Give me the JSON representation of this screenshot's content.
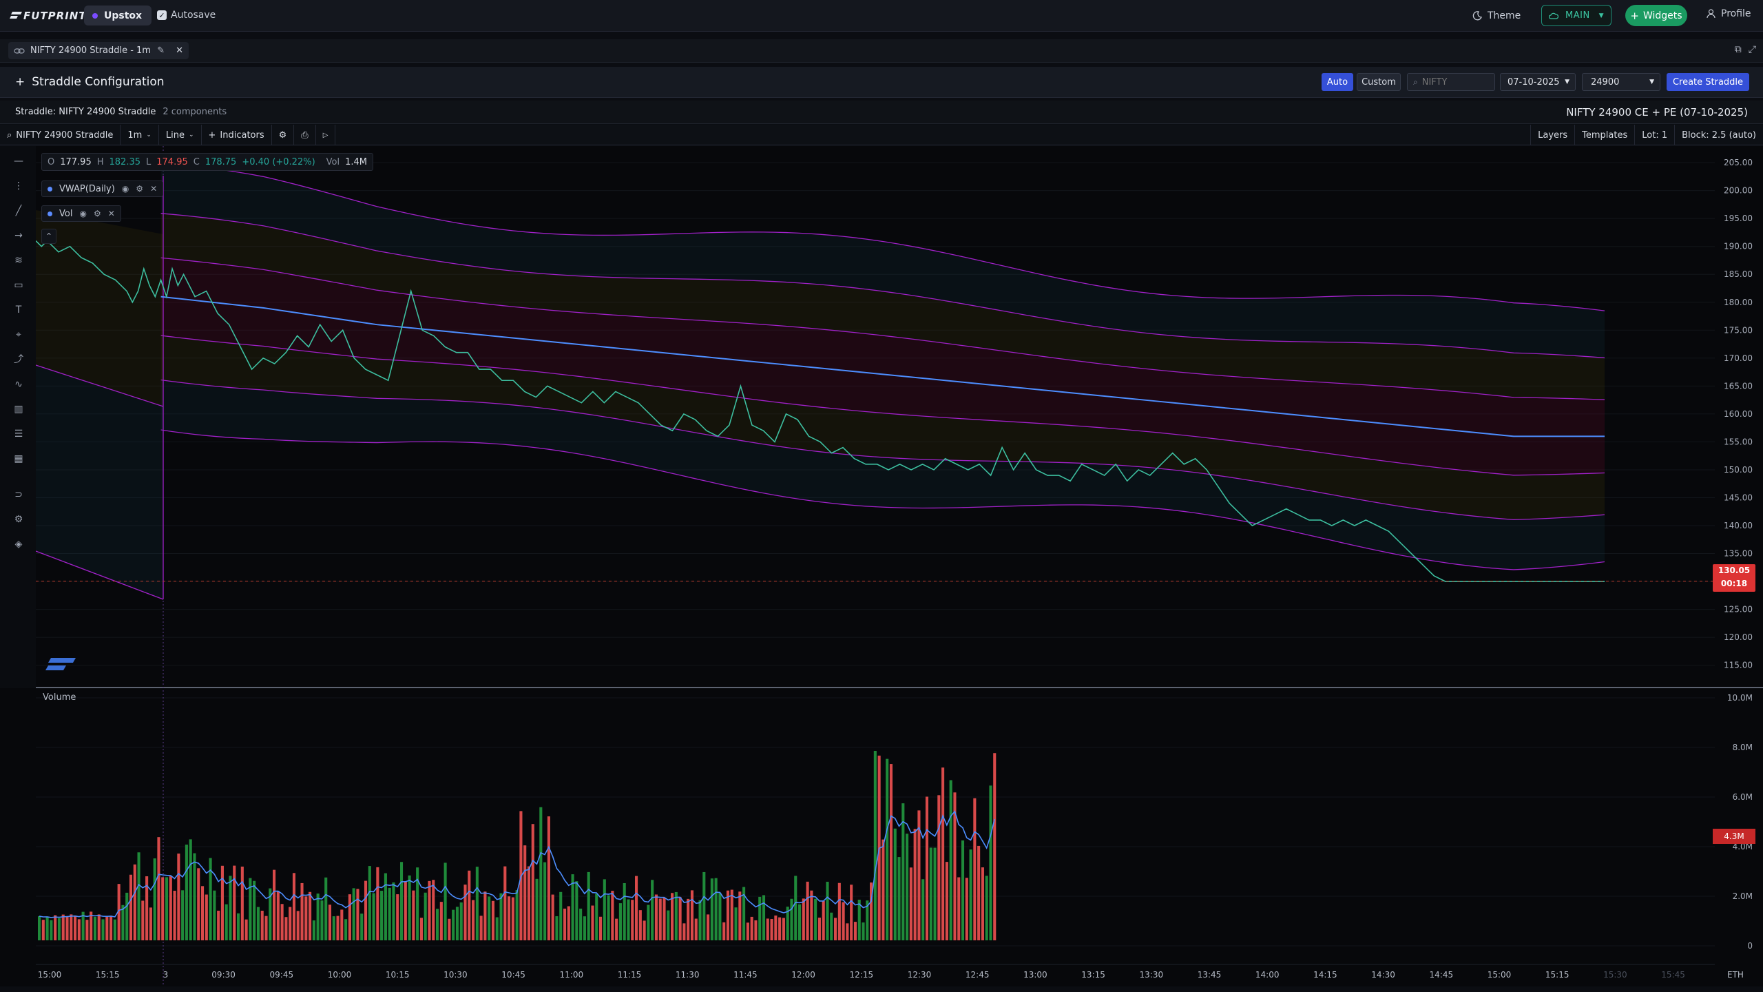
{
  "app": {
    "logo_text": "FUTPRINT",
    "broker": "Upstox",
    "autosave_label": "Autosave",
    "theme_label": "Theme",
    "workspace": "MAIN",
    "widgets_label": "Widgets",
    "profile_label": "Profile"
  },
  "panel": {
    "tab_title": "NIFTY 24900 Straddle - 1m"
  },
  "config": {
    "title": "Straddle Configuration",
    "auto_label": "Auto",
    "custom_label": "Custom",
    "search_placeholder": "NIFTY",
    "date_value": "07-10-2025",
    "strike_value": "24900",
    "create_label": "Create Straddle"
  },
  "info": {
    "straddle_name": "Straddle: NIFTY 24900 Straddle",
    "components": "2 components",
    "contract_desc": "NIFTY 24900 CE + PE (07-10-2025)"
  },
  "toolbar": {
    "symbol": "NIFTY 24900 Straddle",
    "interval": "1m",
    "chart_type": "Line",
    "indicators_label": "Indicators",
    "layers_label": "Layers",
    "templates_label": "Templates",
    "lot_label": "Lot: 1",
    "block_label": "Block: 2.5 (auto)"
  },
  "legend": {
    "o_label": "O",
    "o_val": "177.95",
    "h_label": "H",
    "h_val": "182.35",
    "l_label": "L",
    "l_val": "174.95",
    "c_label": "C",
    "c_val": "178.75",
    "change": "+0.40 (+0.22%)",
    "vol_label": "Vol",
    "vol_val": "1.4M",
    "ind1": "VWAP(Daily)",
    "ind2": "Vol"
  },
  "price_badge": {
    "price": "130.05",
    "countdown": "00:18"
  },
  "volume_badge": "4.3M",
  "volume_title": "Volume",
  "eth_label": "ETH",
  "colors": {
    "up": "#26a69a",
    "down": "#ef5350",
    "price_line": "#3dbfa0",
    "vwap": "#4d8eff",
    "bands": "#a021c8",
    "accent": "#3550d8"
  },
  "chart_data": {
    "type": "line",
    "title": "NIFTY 24900 Straddle - 1m",
    "y_ticks": [
      "205.00",
      "200.00",
      "195.00",
      "190.00",
      "185.00",
      "180.00",
      "175.00",
      "170.00",
      "165.00",
      "160.00",
      "155.00",
      "150.00",
      "145.00",
      "140.00",
      "135.00",
      "130.00",
      "125.00",
      "120.00",
      "115.00"
    ],
    "ylim": [
      112,
      206
    ],
    "x_ticks": [
      "15:00",
      "15:15",
      "3",
      "09:30",
      "09:45",
      "10:00",
      "10:15",
      "10:30",
      "10:45",
      "11:00",
      "11:15",
      "11:30",
      "11:45",
      "12:00",
      "12:15",
      "12:30",
      "12:45",
      "13:00",
      "13:15",
      "13:30",
      "13:45",
      "14:00",
      "14:15",
      "14:30",
      "14:45",
      "15:00",
      "15:15",
      "15:30",
      "15:45"
    ],
    "last_price": 130.05,
    "price_series": {
      "name": "NIFTY 24900 Straddle",
      "x": [
        0,
        5,
        10,
        20,
        30,
        40,
        50,
        60,
        70,
        80,
        85,
        90,
        95,
        100,
        105,
        110,
        115,
        120,
        125,
        130,
        140,
        150,
        160,
        170,
        180,
        190,
        200,
        210,
        220,
        230,
        240,
        250,
        260,
        270,
        280,
        290,
        300,
        310,
        320,
        330,
        340,
        350,
        360,
        370,
        380,
        390,
        400,
        410,
        420,
        430,
        440,
        450,
        460,
        470,
        480,
        490,
        500,
        510,
        520,
        530,
        540,
        550,
        560,
        570,
        580,
        590,
        600,
        610,
        620,
        630,
        640,
        650,
        660,
        670,
        680,
        690,
        700,
        710,
        720,
        730,
        740,
        750,
        760,
        770,
        780,
        790,
        800,
        810,
        820,
        830,
        840,
        850,
        860,
        870,
        880,
        890,
        900,
        910,
        920,
        930,
        940,
        950,
        960,
        970,
        980,
        990,
        1000,
        1010,
        1020,
        1030,
        1040,
        1050,
        1060,
        1070,
        1080,
        1090,
        1100,
        1110,
        1120,
        1130,
        1140,
        1150,
        1160,
        1170,
        1180,
        1190,
        1200,
        1210,
        1220,
        1230,
        1240,
        1250,
        1260,
        1270,
        1280,
        1290,
        1300,
        1310,
        1320,
        1330,
        1340,
        1350,
        1360,
        1370,
        1380
      ],
      "y": [
        191,
        190,
        191,
        189,
        190,
        188,
        187,
        185,
        184,
        182,
        180,
        182,
        186,
        183,
        181,
        184,
        181,
        186,
        183,
        185,
        181,
        182,
        178,
        176,
        172,
        168,
        170,
        169,
        171,
        174,
        172,
        176,
        173,
        175,
        170,
        168,
        167,
        166,
        174,
        182,
        175,
        174,
        172,
        171,
        171,
        168,
        168,
        166,
        166,
        164,
        163,
        165,
        164,
        163,
        162,
        164,
        162,
        164,
        163,
        162,
        160,
        158,
        157,
        160,
        159,
        157,
        156,
        158,
        165,
        158,
        157,
        155,
        160,
        159,
        156,
        155,
        153,
        154,
        152,
        151,
        151,
        150,
        151,
        150,
        151,
        150,
        152,
        151,
        150,
        151,
        149,
        154,
        150,
        153,
        150,
        149,
        149,
        148,
        151,
        150,
        149,
        151,
        148,
        150,
        149,
        151,
        153,
        151,
        152,
        150,
        147,
        144,
        142,
        140,
        141,
        142,
        143,
        142,
        141,
        141,
        140,
        141,
        140,
        141,
        140,
        139,
        137,
        135,
        133,
        131,
        130,
        130,
        130,
        130,
        130,
        130,
        130,
        130,
        130,
        130,
        130,
        130,
        130,
        130,
        130
      ]
    },
    "vwap_series": {
      "name": "VWAP(Daily)",
      "x": [
        110,
        200,
        300,
        400,
        500,
        600,
        700,
        800,
        900,
        1000,
        1100,
        1150,
        1200,
        1300,
        1380
      ],
      "y": [
        181,
        179,
        176,
        174,
        172,
        170,
        168,
        166,
        164,
        162,
        160,
        159,
        158,
        156,
        156
      ]
    },
    "volume": {
      "title": "Volume",
      "y_ticks": [
        "10.0M",
        "8.0M",
        "6.0M",
        "4.0M",
        "2.0M",
        "0"
      ],
      "ylim": [
        0,
        10
      ]
    }
  }
}
